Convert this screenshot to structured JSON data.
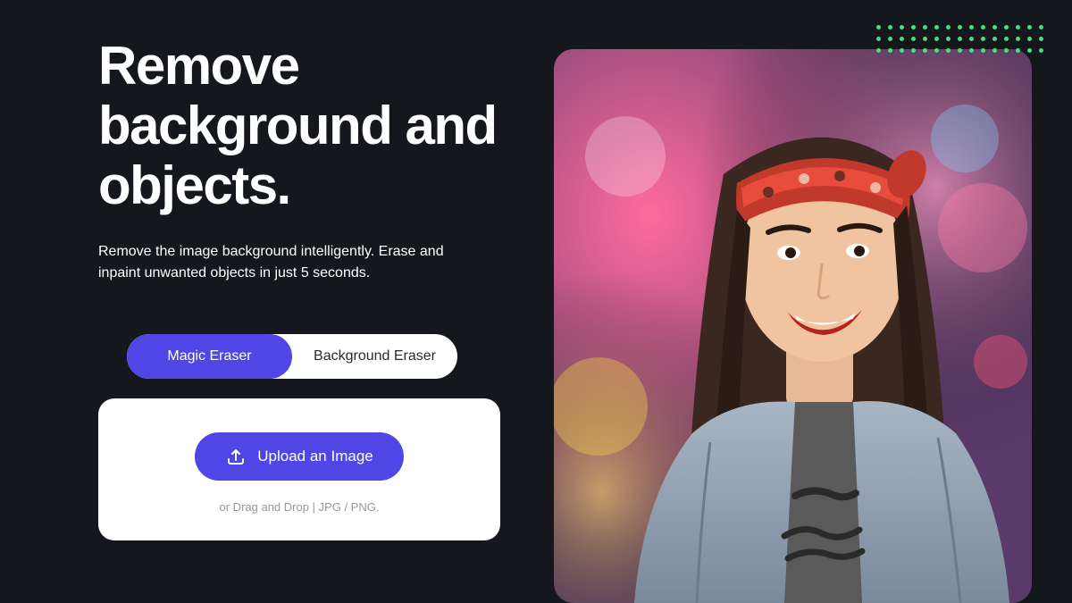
{
  "hero": {
    "headline": "Remove background and objects.",
    "subheadline": "Remove the image background intelligently. Erase and inpaint unwanted objects in just 5 seconds."
  },
  "toggle": {
    "active_label": "Magic Eraser",
    "inactive_label": "Background Eraser"
  },
  "upload": {
    "button_label": "Upload an Image",
    "drag_text": "or Drag and Drop | JPG / PNG."
  },
  "colors": {
    "accent": "#4f46e5",
    "bg": "#14171c",
    "dot": "#4ade80"
  }
}
